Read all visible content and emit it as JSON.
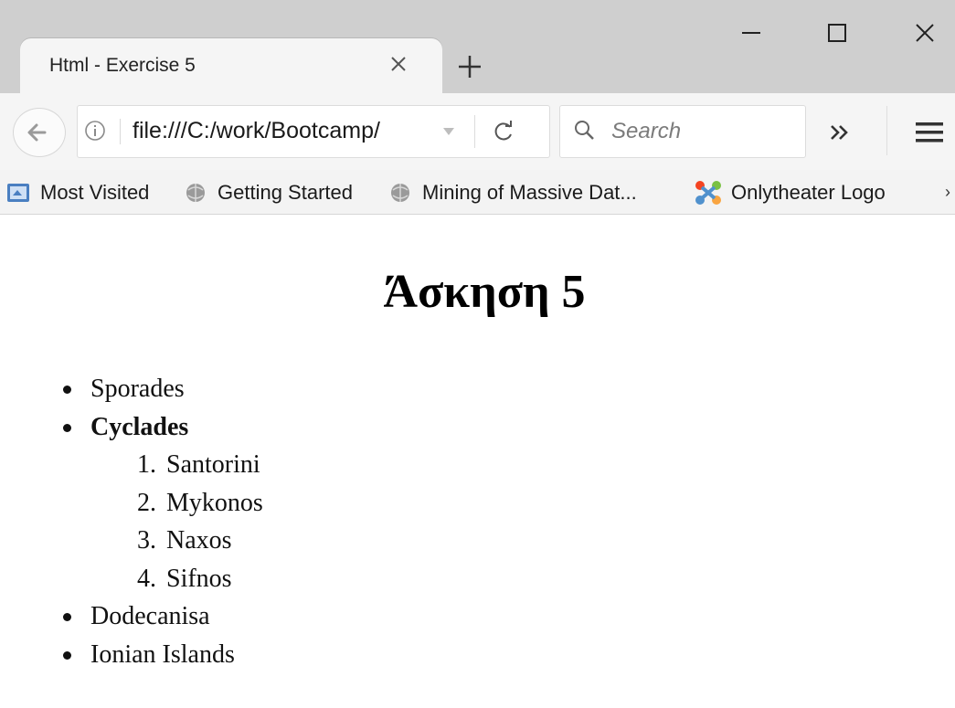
{
  "browser": {
    "tab": {
      "title": "Html - Exercise 5"
    },
    "url": "file:///C:/work/Bootcamp/",
    "search_placeholder": "Search",
    "bookmarks": [
      {
        "label": "Most Visited",
        "icon": "bookmark-folder-icon"
      },
      {
        "label": "Getting Started",
        "icon": "globe-icon"
      },
      {
        "label": "Mining of Massive Dat...",
        "icon": "globe-icon"
      },
      {
        "label": "Onlytheater Logo",
        "icon": "joomla-icon"
      }
    ]
  },
  "page": {
    "heading": "Άσκηση 5",
    "list": [
      {
        "label": "Sporades",
        "bold": false
      },
      {
        "label": "Cyclades",
        "bold": true,
        "sublist": [
          {
            "num": "1.",
            "label": "Santorini"
          },
          {
            "num": "2.",
            "label": "Mykonos"
          },
          {
            "num": "3.",
            "label": "Naxos"
          },
          {
            "num": "4.",
            "label": "Sifnos"
          }
        ]
      },
      {
        "label": "Dodecanisa",
        "bold": false
      },
      {
        "label": "Ionian Islands",
        "bold": false
      }
    ]
  },
  "colors": {
    "tabstrip_bg": "#cfcfcf",
    "toolbar_bg": "#f5f5f5",
    "page_bg": "#ffffff",
    "text": "#111111"
  }
}
